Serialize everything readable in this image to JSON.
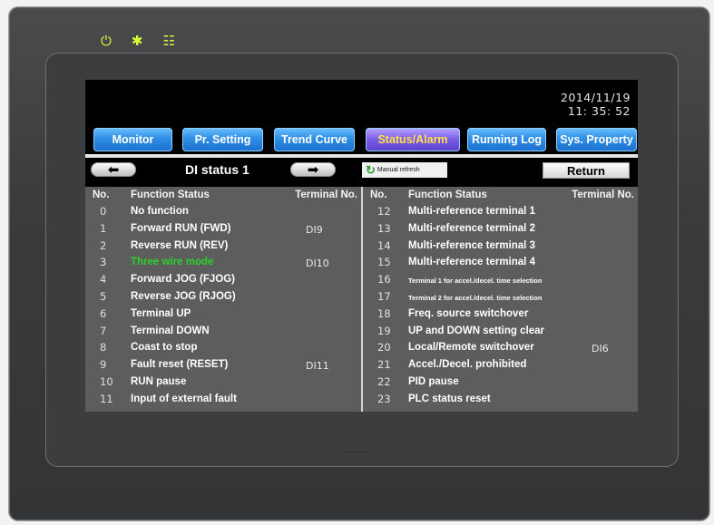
{
  "status_leds": [
    {
      "icon": "power-icon",
      "glyph": "⏻"
    },
    {
      "icon": "sun-icon",
      "glyph": "✱"
    },
    {
      "icon": "network-icon",
      "glyph": "☷"
    }
  ],
  "datetime": {
    "date": "2014/11/19",
    "time": "11: 35: 52"
  },
  "tabs": [
    {
      "label": "Monitor",
      "active": false
    },
    {
      "label": "Pr. Setting",
      "active": false
    },
    {
      "label": "Trend Curve",
      "active": false
    },
    {
      "label": "Status/Alarm",
      "active": true
    },
    {
      "label": "Running Log",
      "active": false
    },
    {
      "label": "Sys. Property",
      "active": false
    }
  ],
  "toolbar": {
    "prev_icon": "arrow-left-icon",
    "next_icon": "arrow-right-icon",
    "page_title": "DI status 1",
    "refresh_label": "Manual refresh",
    "return_label": "Return"
  },
  "table": {
    "headers": {
      "no": "No.",
      "function": "Function Status",
      "terminal": "Terminal No."
    },
    "left_rows": [
      {
        "no": "0",
        "function": "No function",
        "terminal": ""
      },
      {
        "no": "1",
        "function": "Forward RUN (FWD)",
        "terminal": "DI9"
      },
      {
        "no": "2",
        "function": "Reverse RUN (REV)",
        "terminal": ""
      },
      {
        "no": "3",
        "function": "Three wire mode",
        "terminal": "DI10"
      },
      {
        "no": "4",
        "function": "Forward JOG (FJOG)",
        "terminal": ""
      },
      {
        "no": "5",
        "function": "Reverse JOG (RJOG)",
        "terminal": ""
      },
      {
        "no": "6",
        "function": "Terminal UP",
        "terminal": ""
      },
      {
        "no": "7",
        "function": "Terminal DOWN",
        "terminal": ""
      },
      {
        "no": "8",
        "function": "Coast to stop",
        "terminal": ""
      },
      {
        "no": "9",
        "function": "Fault reset (RESET)",
        "terminal": "DI11"
      },
      {
        "no": "10",
        "function": "RUN pause",
        "terminal": ""
      },
      {
        "no": "11",
        "function": "Input of external fault",
        "terminal": ""
      }
    ],
    "right_rows": [
      {
        "no": "12",
        "function": "Multi-reference terminal 1",
        "terminal": ""
      },
      {
        "no": "13",
        "function": "Multi-reference terminal 2",
        "terminal": ""
      },
      {
        "no": "14",
        "function": "Multi-reference terminal 3",
        "terminal": ""
      },
      {
        "no": "15",
        "function": "Multi-reference terminal 4",
        "terminal": ""
      },
      {
        "no": "16",
        "function": "Terminal 1 for accel./decel. time selection",
        "terminal": ""
      },
      {
        "no": "17",
        "function": "Terminal 2 for accel./decel. time selection",
        "terminal": ""
      },
      {
        "no": "18",
        "function": "Freq. source switchover",
        "terminal": ""
      },
      {
        "no": "19",
        "function": "UP and DOWN setting clear",
        "terminal": ""
      },
      {
        "no": "20",
        "function": "Local/Remote switchover",
        "terminal": "DI6"
      },
      {
        "no": "21",
        "function": "Accel./Decel. prohibited",
        "terminal": ""
      },
      {
        "no": "22",
        "function": "PID pause",
        "terminal": ""
      },
      {
        "no": "23",
        "function": "PLC status reset",
        "terminal": ""
      }
    ],
    "highlight_color": "#2bd12b"
  }
}
